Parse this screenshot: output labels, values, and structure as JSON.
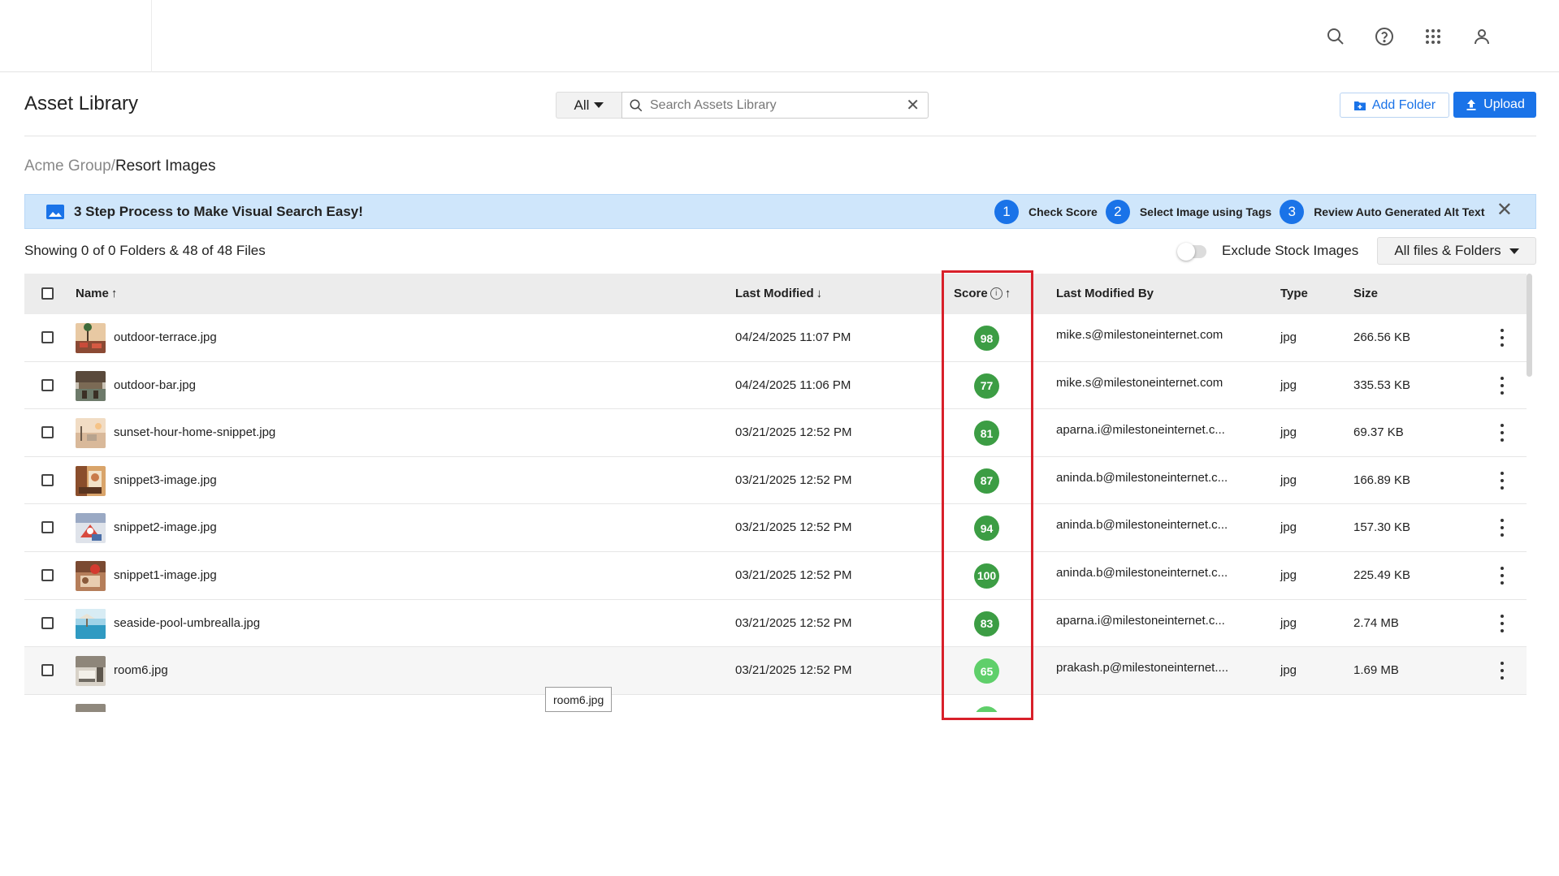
{
  "topnav": {
    "icons": [
      "search-icon",
      "help-icon",
      "apps-grid-icon",
      "user-icon"
    ]
  },
  "header": {
    "title": "Asset Library",
    "filter_value": "All",
    "search_placeholder": "Search Assets Library",
    "add_folder_label": "Add Folder",
    "upload_label": "Upload"
  },
  "breadcrumb": {
    "root": "Acme Group/",
    "current": "Resort Images"
  },
  "banner": {
    "title": "3 Step Process to Make Visual Search Easy!",
    "steps": [
      {
        "num": "1",
        "label": "Check Score"
      },
      {
        "num": "2",
        "label": "Select Image using Tags"
      },
      {
        "num": "3",
        "label": "Review Auto Generated Alt Text"
      }
    ]
  },
  "summary": {
    "showing": "Showing 0 of 0 Folders & 48 of 48 Files",
    "exclude_label": "Exclude Stock Images",
    "exclude_on": false,
    "view_filter": "All files & Folders"
  },
  "table": {
    "headers": {
      "name": "Name",
      "last_modified": "Last Modified",
      "score": "Score",
      "last_modified_by": "Last Modified By",
      "type": "Type",
      "size": "Size"
    },
    "rows": [
      {
        "name": "outdoor-terrace.jpg",
        "modified": "04/24/2025 11:07 PM",
        "score": "98",
        "by": "mike.s@milestoneinternet.com",
        "type": "jpg",
        "size": "266.56 KB"
      },
      {
        "name": "outdoor-bar.jpg",
        "modified": "04/24/2025 11:06 PM",
        "score": "77",
        "by": "mike.s@milestoneinternet.com",
        "type": "jpg",
        "size": "335.53 KB"
      },
      {
        "name": "sunset-hour-home-snippet.jpg",
        "modified": "03/21/2025 12:52 PM",
        "score": "81",
        "by": "aparna.i@milestoneinternet.c...",
        "type": "jpg",
        "size": "69.37 KB"
      },
      {
        "name": "snippet3-image.jpg",
        "modified": "03/21/2025 12:52 PM",
        "score": "87",
        "by": "aninda.b@milestoneinternet.c...",
        "type": "jpg",
        "size": "166.89 KB"
      },
      {
        "name": "snippet2-image.jpg",
        "modified": "03/21/2025 12:52 PM",
        "score": "94",
        "by": "aninda.b@milestoneinternet.c...",
        "type": "jpg",
        "size": "157.30 KB"
      },
      {
        "name": "snippet1-image.jpg",
        "modified": "03/21/2025 12:52 PM",
        "score": "100",
        "by": "aninda.b@milestoneinternet.c...",
        "type": "jpg",
        "size": "225.49 KB"
      },
      {
        "name": "seaside-pool-umbrealla.jpg",
        "modified": "03/21/2025 12:52 PM",
        "score": "83",
        "by": "aparna.i@milestoneinternet.c...",
        "type": "jpg",
        "size": "2.74 MB"
      },
      {
        "name": "room6.jpg",
        "modified": "03/21/2025 12:52 PM",
        "score": "65",
        "by": "prakash.p@milestoneinternet....",
        "type": "jpg",
        "size": "1.69 MB"
      }
    ]
  },
  "tooltip": "room6.jpg",
  "colors": {
    "accent": "#1a73e8",
    "score_high": "#3c9d44",
    "score_mid": "#5fcf6a",
    "highlight": "#d8202a",
    "banner_bg": "#cfe6fb"
  }
}
